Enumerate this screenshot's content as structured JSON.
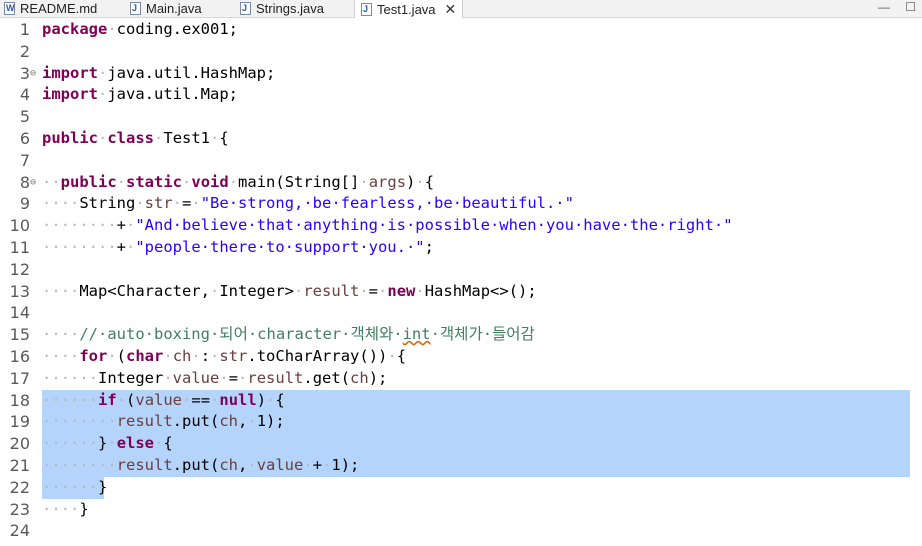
{
  "tabs": [
    {
      "label": "README.md",
      "icon": "markdown-file-icon",
      "icon_glyph": "W"
    },
    {
      "label": "Main.java",
      "icon": "java-file-icon",
      "icon_glyph": "J"
    },
    {
      "label": "Strings.java",
      "icon": "java-file-icon",
      "icon_glyph": "J"
    },
    {
      "label": "Test1.java",
      "icon": "java-file-icon",
      "icon_glyph": "J",
      "active": true,
      "close": "✕"
    }
  ],
  "window_controls": {
    "minimize": "—",
    "maximize": "☐"
  },
  "colors": {
    "keyword": "#7f0055",
    "string": "#2a00ff",
    "comment": "#3f7f5f",
    "variable": "#6a3e3e",
    "selection": "#b5d4fb"
  },
  "editor": {
    "selected_lines": [
      18,
      19,
      20,
      21,
      22
    ],
    "lines": [
      {
        "n": "1",
        "fold": "",
        "tokens": [
          [
            "kw",
            "package"
          ],
          [
            "ws",
            "·"
          ],
          [
            "t",
            "coding.ex001;"
          ]
        ]
      },
      {
        "n": "2",
        "fold": "",
        "tokens": []
      },
      {
        "n": "3",
        "fold": "⊖",
        "tokens": [
          [
            "kw",
            "import"
          ],
          [
            "ws",
            "·"
          ],
          [
            "t",
            "java.util.HashMap;"
          ]
        ]
      },
      {
        "n": "4",
        "fold": "",
        "tokens": [
          [
            "kw",
            "import"
          ],
          [
            "ws",
            "·"
          ],
          [
            "t",
            "java.util.Map;"
          ]
        ]
      },
      {
        "n": "5",
        "fold": "",
        "tokens": []
      },
      {
        "n": "6",
        "fold": "",
        "tokens": [
          [
            "kw",
            "public"
          ],
          [
            "ws",
            "·"
          ],
          [
            "kw",
            "class"
          ],
          [
            "ws",
            "·"
          ],
          [
            "t",
            "Test1"
          ],
          [
            "ws",
            "·"
          ],
          [
            "t",
            "{"
          ]
        ]
      },
      {
        "n": "7",
        "fold": "",
        "tokens": []
      },
      {
        "n": "8",
        "fold": "⊖",
        "tokens": [
          [
            "ws",
            "··"
          ],
          [
            "kw",
            "public"
          ],
          [
            "ws",
            "·"
          ],
          [
            "kw",
            "static"
          ],
          [
            "ws",
            "·"
          ],
          [
            "kw",
            "void"
          ],
          [
            "ws",
            "·"
          ],
          [
            "t",
            "main(String[]"
          ],
          [
            "ws",
            "·"
          ],
          [
            "var",
            "args"
          ],
          [
            "t",
            ")"
          ],
          [
            "ws",
            "·"
          ],
          [
            "t",
            "{"
          ]
        ]
      },
      {
        "n": "9",
        "fold": "",
        "tokens": [
          [
            "ws",
            "····"
          ],
          [
            "t",
            "String"
          ],
          [
            "ws",
            "·"
          ],
          [
            "var",
            "str"
          ],
          [
            "ws",
            "·"
          ],
          [
            "t",
            "="
          ],
          [
            "ws",
            "·"
          ],
          [
            "str",
            "\"Be·strong,·be·fearless,·be·beautiful.·\""
          ]
        ]
      },
      {
        "n": "10",
        "fold": "",
        "tokens": [
          [
            "ws",
            "········"
          ],
          [
            "t",
            "+"
          ],
          [
            "ws",
            "·"
          ],
          [
            "str",
            "\"And·believe·that·anything·is·possible·when·you·have·the·right·\""
          ]
        ]
      },
      {
        "n": "11",
        "fold": "",
        "tokens": [
          [
            "ws",
            "········"
          ],
          [
            "t",
            "+"
          ],
          [
            "ws",
            "·"
          ],
          [
            "str",
            "\"people·there·to·support·you.·\""
          ],
          [
            "t",
            ";"
          ]
        ]
      },
      {
        "n": "12",
        "fold": "",
        "tokens": []
      },
      {
        "n": "13",
        "fold": "",
        "tokens": [
          [
            "ws",
            "····"
          ],
          [
            "t",
            "Map<Character,"
          ],
          [
            "ws",
            "·"
          ],
          [
            "t",
            "Integer>"
          ],
          [
            "ws",
            "·"
          ],
          [
            "var",
            "result"
          ],
          [
            "ws",
            "·"
          ],
          [
            "t",
            "="
          ],
          [
            "ws",
            "·"
          ],
          [
            "kw",
            "new"
          ],
          [
            "ws",
            "·"
          ],
          [
            "t",
            "HashMap<>();"
          ]
        ]
      },
      {
        "n": "14",
        "fold": "",
        "tokens": []
      },
      {
        "n": "15",
        "fold": "",
        "tokens": [
          [
            "ws",
            "····"
          ],
          [
            "cmt",
            "//·auto·boxing·되어·character·객체와·"
          ],
          [
            "cmtsq",
            "int"
          ],
          [
            "cmt",
            "·객체가·들어감"
          ]
        ]
      },
      {
        "n": "16",
        "fold": "",
        "tokens": [
          [
            "ws",
            "····"
          ],
          [
            "kw",
            "for"
          ],
          [
            "ws",
            "·"
          ],
          [
            "t",
            "("
          ],
          [
            "kw",
            "char"
          ],
          [
            "ws",
            "·"
          ],
          [
            "var",
            "ch"
          ],
          [
            "ws",
            "·"
          ],
          [
            "t",
            ":"
          ],
          [
            "ws",
            "·"
          ],
          [
            "var",
            "str"
          ],
          [
            "t",
            ".toCharArray())"
          ],
          [
            "ws",
            "·"
          ],
          [
            "t",
            "{"
          ]
        ]
      },
      {
        "n": "17",
        "fold": "",
        "tokens": [
          [
            "ws",
            "······"
          ],
          [
            "t",
            "Integer"
          ],
          [
            "ws",
            "·"
          ],
          [
            "var",
            "value"
          ],
          [
            "ws",
            "·"
          ],
          [
            "t",
            "="
          ],
          [
            "ws",
            "·"
          ],
          [
            "var",
            "result"
          ],
          [
            "t",
            ".get("
          ],
          [
            "var",
            "ch"
          ],
          [
            "t",
            ");"
          ]
        ]
      },
      {
        "n": "18",
        "fold": "",
        "tokens": [
          [
            "ws",
            "······"
          ],
          [
            "kw",
            "if"
          ],
          [
            "ws",
            "·"
          ],
          [
            "t",
            "("
          ],
          [
            "var",
            "value"
          ],
          [
            "ws",
            "·"
          ],
          [
            "t",
            "=="
          ],
          [
            "ws",
            "·"
          ],
          [
            "kw",
            "null"
          ],
          [
            "t",
            ")"
          ],
          [
            "ws",
            "·"
          ],
          [
            "t",
            "{"
          ]
        ]
      },
      {
        "n": "19",
        "fold": "",
        "tokens": [
          [
            "ws",
            "········"
          ],
          [
            "var",
            "result"
          ],
          [
            "t",
            ".put("
          ],
          [
            "var",
            "ch"
          ],
          [
            "t",
            ","
          ],
          [
            "ws",
            "·"
          ],
          [
            "t",
            "1);"
          ]
        ]
      },
      {
        "n": "20",
        "fold": "",
        "tokens": [
          [
            "ws",
            "······"
          ],
          [
            "t",
            "}"
          ],
          [
            "ws",
            "·"
          ],
          [
            "kw",
            "else"
          ],
          [
            "ws",
            "·"
          ],
          [
            "t",
            "{"
          ]
        ]
      },
      {
        "n": "21",
        "fold": "",
        "tokens": [
          [
            "ws",
            "········"
          ],
          [
            "var",
            "result"
          ],
          [
            "t",
            ".put("
          ],
          [
            "var",
            "ch"
          ],
          [
            "t",
            ","
          ],
          [
            "ws",
            "·"
          ],
          [
            "var",
            "value"
          ],
          [
            "ws",
            "·"
          ],
          [
            "t",
            "+"
          ],
          [
            "ws",
            "·"
          ],
          [
            "t",
            "1);"
          ]
        ]
      },
      {
        "n": "22",
        "fold": "",
        "tokens": [
          [
            "ws",
            "······"
          ],
          [
            "t",
            "}"
          ]
        ]
      },
      {
        "n": "23",
        "fold": "",
        "tokens": [
          [
            "ws",
            "····"
          ],
          [
            "t",
            "}"
          ]
        ]
      },
      {
        "n": "24",
        "fold": "",
        "tokens": []
      }
    ]
  }
}
